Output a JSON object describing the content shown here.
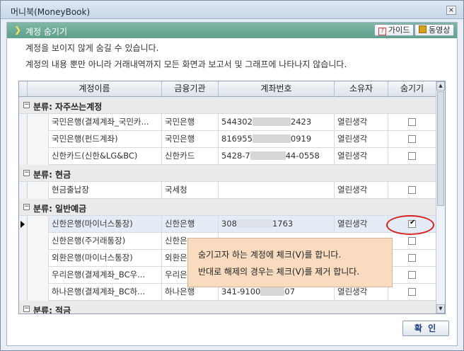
{
  "window": {
    "title": "머니북(MoneyBook)",
    "close": "×"
  },
  "header": {
    "title": "계정 숨기기",
    "guide_label": "가이드",
    "video_label": "동영상"
  },
  "description": {
    "line1": "계정을 보이지 않게 숨길 수 있습니다.",
    "line2": "계정의 내용 뿐만 아니라 거래내역까지 모든 화면과 보고서 및 그래프에 나타나지 않습니다."
  },
  "grid": {
    "columns": [
      "계정이름",
      "금융기관",
      "계좌번호",
      "소유자",
      "숨기기"
    ],
    "groups": [
      {
        "label": "분류: 자주쓰는계정",
        "rows": [
          {
            "name": "국민은행(결제계좌_국민카...",
            "bank": "국민은행",
            "acct_a": "544302",
            "acct_b": "2423",
            "owner": "열린생각",
            "hidden": false
          },
          {
            "name": "국민은행(펀드계좌)",
            "bank": "국민은행",
            "acct_a": "816955",
            "acct_b": "0919",
            "owner": "열린생각",
            "hidden": false
          },
          {
            "name": "신한카드(신한&LG&BC)",
            "bank": "신한카드",
            "acct_a": "5428-7",
            "acct_b": "44-0558",
            "owner": "열린생각",
            "hidden": false
          }
        ]
      },
      {
        "label": "분류: 현금",
        "rows": [
          {
            "name": "현금출납장",
            "bank": "국세청",
            "acct_a": "",
            "acct_b": "",
            "owner": "열린생각",
            "hidden": false
          }
        ]
      },
      {
        "label": "분류: 일반예금",
        "rows": [
          {
            "name": "신한은행(마이너스통장)",
            "bank": "신한은행",
            "acct_a": "308",
            "acct_b": "1763",
            "owner": "열린생각",
            "hidden": true
          },
          {
            "name": "신한은행(주거래통장)",
            "bank": "신한은",
            "acct_a": "",
            "acct_b": "",
            "owner": "",
            "hidden": false
          },
          {
            "name": "외환은행(마이너스통장)",
            "bank": "외환은",
            "acct_a": "",
            "acct_b": "",
            "owner": "",
            "hidden": false
          },
          {
            "name": "우리은행(결제계좌_BC우...",
            "bank": "우리은",
            "acct_a": "",
            "acct_b": "",
            "owner": "",
            "hidden": false
          },
          {
            "name": "하나은행(결제계좌_BC하...",
            "bank": "하나은행",
            "acct_a": "341-9100",
            "acct_b": "07",
            "owner": "열린생각",
            "hidden": false
          }
        ]
      },
      {
        "label": "분류: 적금",
        "rows": []
      }
    ]
  },
  "tooltip": {
    "line1": "숨기고자 하는 계정에 체크(V)를 합니다.",
    "line2": "반대로 해제의 경우는 체크(V)를 제거 합니다."
  },
  "confirm_label": "확 인"
}
